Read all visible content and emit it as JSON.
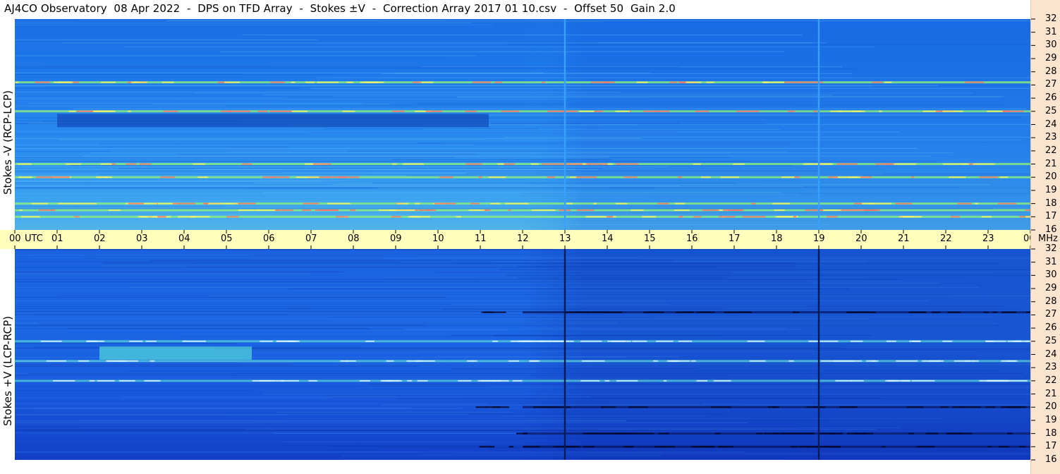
{
  "title": "AJ4CO Observatory  08 Apr 2022  -  DPS on TFD Array  -  Stokes ±V  -  Correction Array 2017 01 10.csv  -  Offset 50  Gain 2.0",
  "colors": {
    "background": "#ffffff",
    "time_axis_bg": "#fffebd",
    "freq_axis_bg": "#fde4cf",
    "top_base": "#1e78ea",
    "bottom_base": "#1656e0"
  },
  "chart_data": [
    {
      "type": "heatmap",
      "panel": "top",
      "ylabel": "Stokes -V (RCP-LCP)",
      "x_unit": "UTC",
      "x_range": [
        "00",
        "00"
      ],
      "y_unit": "MHz",
      "ylim": [
        16,
        32
      ],
      "y_ticks": [
        32,
        31,
        30,
        29,
        28,
        27,
        26,
        25,
        24,
        23,
        22,
        21,
        20,
        19,
        18,
        17,
        16
      ],
      "vertical_lines_utc": [
        13.0,
        19.0
      ],
      "vertical_line_color": "#3aa0ff",
      "bright_bands_mhz": [
        27.2,
        25.0,
        21.0,
        20.0,
        18.0,
        17.5,
        17.0
      ],
      "dark_block": {
        "utc_start": 1.0,
        "utc_end": 11.2,
        "mhz_low": 23.8,
        "mhz_high": 24.8
      }
    },
    {
      "type": "heatmap",
      "panel": "bottom",
      "ylabel": "Stokes +V (LCP-RCP)",
      "x_unit": "UTC",
      "x_range": [
        "00",
        "00"
      ],
      "y_unit": "MHz",
      "ylim": [
        16,
        32
      ],
      "y_ticks": [
        32,
        31,
        30,
        29,
        28,
        27,
        26,
        25,
        24,
        23,
        22,
        21,
        20,
        19,
        18,
        17,
        16
      ],
      "vertical_lines_utc": [
        13.0,
        19.0
      ],
      "vertical_line_color": "#0a1a55",
      "bright_bands_mhz": [
        25.0,
        23.5,
        22.0
      ],
      "dark_bands_mhz": [
        27.2,
        20.0,
        18.0,
        17.0
      ],
      "bright_block": {
        "utc_start": 2.0,
        "utc_end": 5.6,
        "mhz_low": 23.6,
        "mhz_high": 24.6
      }
    }
  ],
  "time_axis": {
    "labels": [
      "00",
      "01",
      "02",
      "03",
      "04",
      "05",
      "06",
      "07",
      "08",
      "09",
      "10",
      "11",
      "12",
      "13",
      "14",
      "15",
      "16",
      "17",
      "18",
      "19",
      "20",
      "21",
      "22",
      "23",
      "00"
    ],
    "utc_label": "UTC",
    "unit_label": "MHz"
  }
}
